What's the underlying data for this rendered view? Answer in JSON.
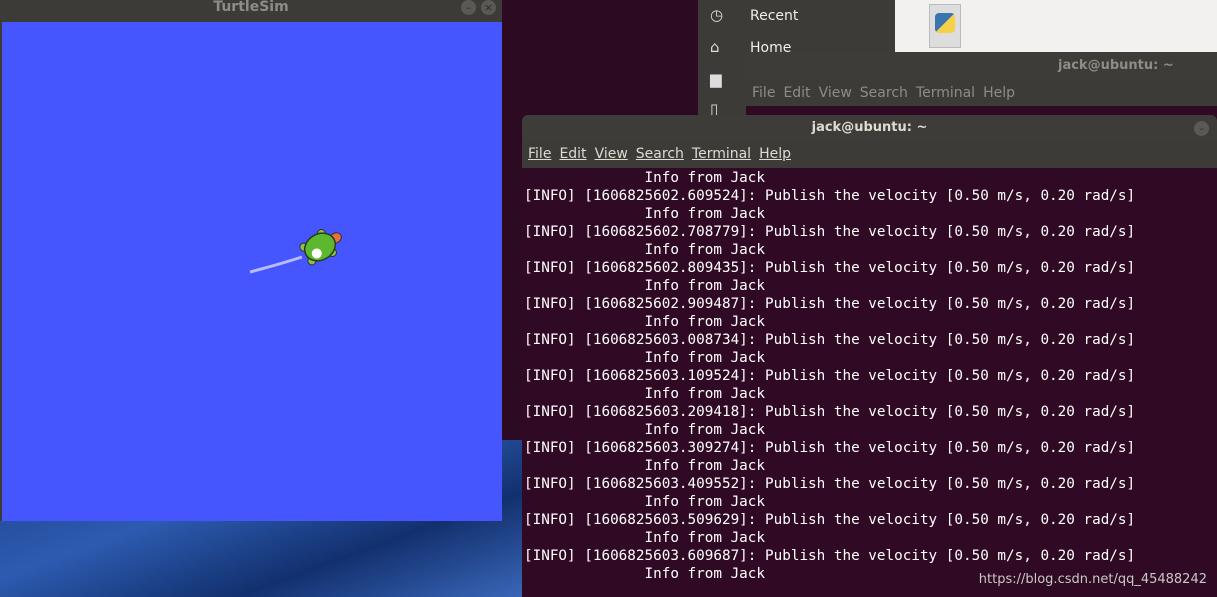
{
  "turtlesim": {
    "title": "TurtleSim",
    "background": "#4556ff"
  },
  "files": {
    "sidebar": [
      {
        "icon": "clock-icon",
        "label": "Recent"
      },
      {
        "icon": "home-icon",
        "label": "Home"
      }
    ]
  },
  "back_terminal": {
    "title": "jack@ubuntu: ~",
    "menu": [
      "File",
      "Edit",
      "View",
      "Search",
      "Terminal",
      "Help"
    ]
  },
  "terminal": {
    "title": "jack@ubuntu: ~",
    "menu": [
      "File",
      "Edit",
      "View",
      "Search",
      "Terminal",
      "Help"
    ],
    "lines": [
      "              Info from Jack",
      "[INFO] [1606825602.609524]: Publish the velocity [0.50 m/s, 0.20 rad/s]",
      "              Info from Jack",
      "[INFO] [1606825602.708779]: Publish the velocity [0.50 m/s, 0.20 rad/s]",
      "              Info from Jack",
      "[INFO] [1606825602.809435]: Publish the velocity [0.50 m/s, 0.20 rad/s]",
      "              Info from Jack",
      "[INFO] [1606825602.909487]: Publish the velocity [0.50 m/s, 0.20 rad/s]",
      "              Info from Jack",
      "[INFO] [1606825603.008734]: Publish the velocity [0.50 m/s, 0.20 rad/s]",
      "              Info from Jack",
      "[INFO] [1606825603.109524]: Publish the velocity [0.50 m/s, 0.20 rad/s]",
      "              Info from Jack",
      "[INFO] [1606825603.209418]: Publish the velocity [0.50 m/s, 0.20 rad/s]",
      "              Info from Jack",
      "[INFO] [1606825603.309274]: Publish the velocity [0.50 m/s, 0.20 rad/s]",
      "              Info from Jack",
      "[INFO] [1606825603.409552]: Publish the velocity [0.50 m/s, 0.20 rad/s]",
      "              Info from Jack",
      "[INFO] [1606825603.509629]: Publish the velocity [0.50 m/s, 0.20 rad/s]",
      "              Info from Jack",
      "[INFO] [1606825603.609687]: Publish the velocity [0.50 m/s, 0.20 rad/s]",
      "              Info from Jack"
    ]
  },
  "watermark": "https://blog.csdn.net/qq_45488242"
}
